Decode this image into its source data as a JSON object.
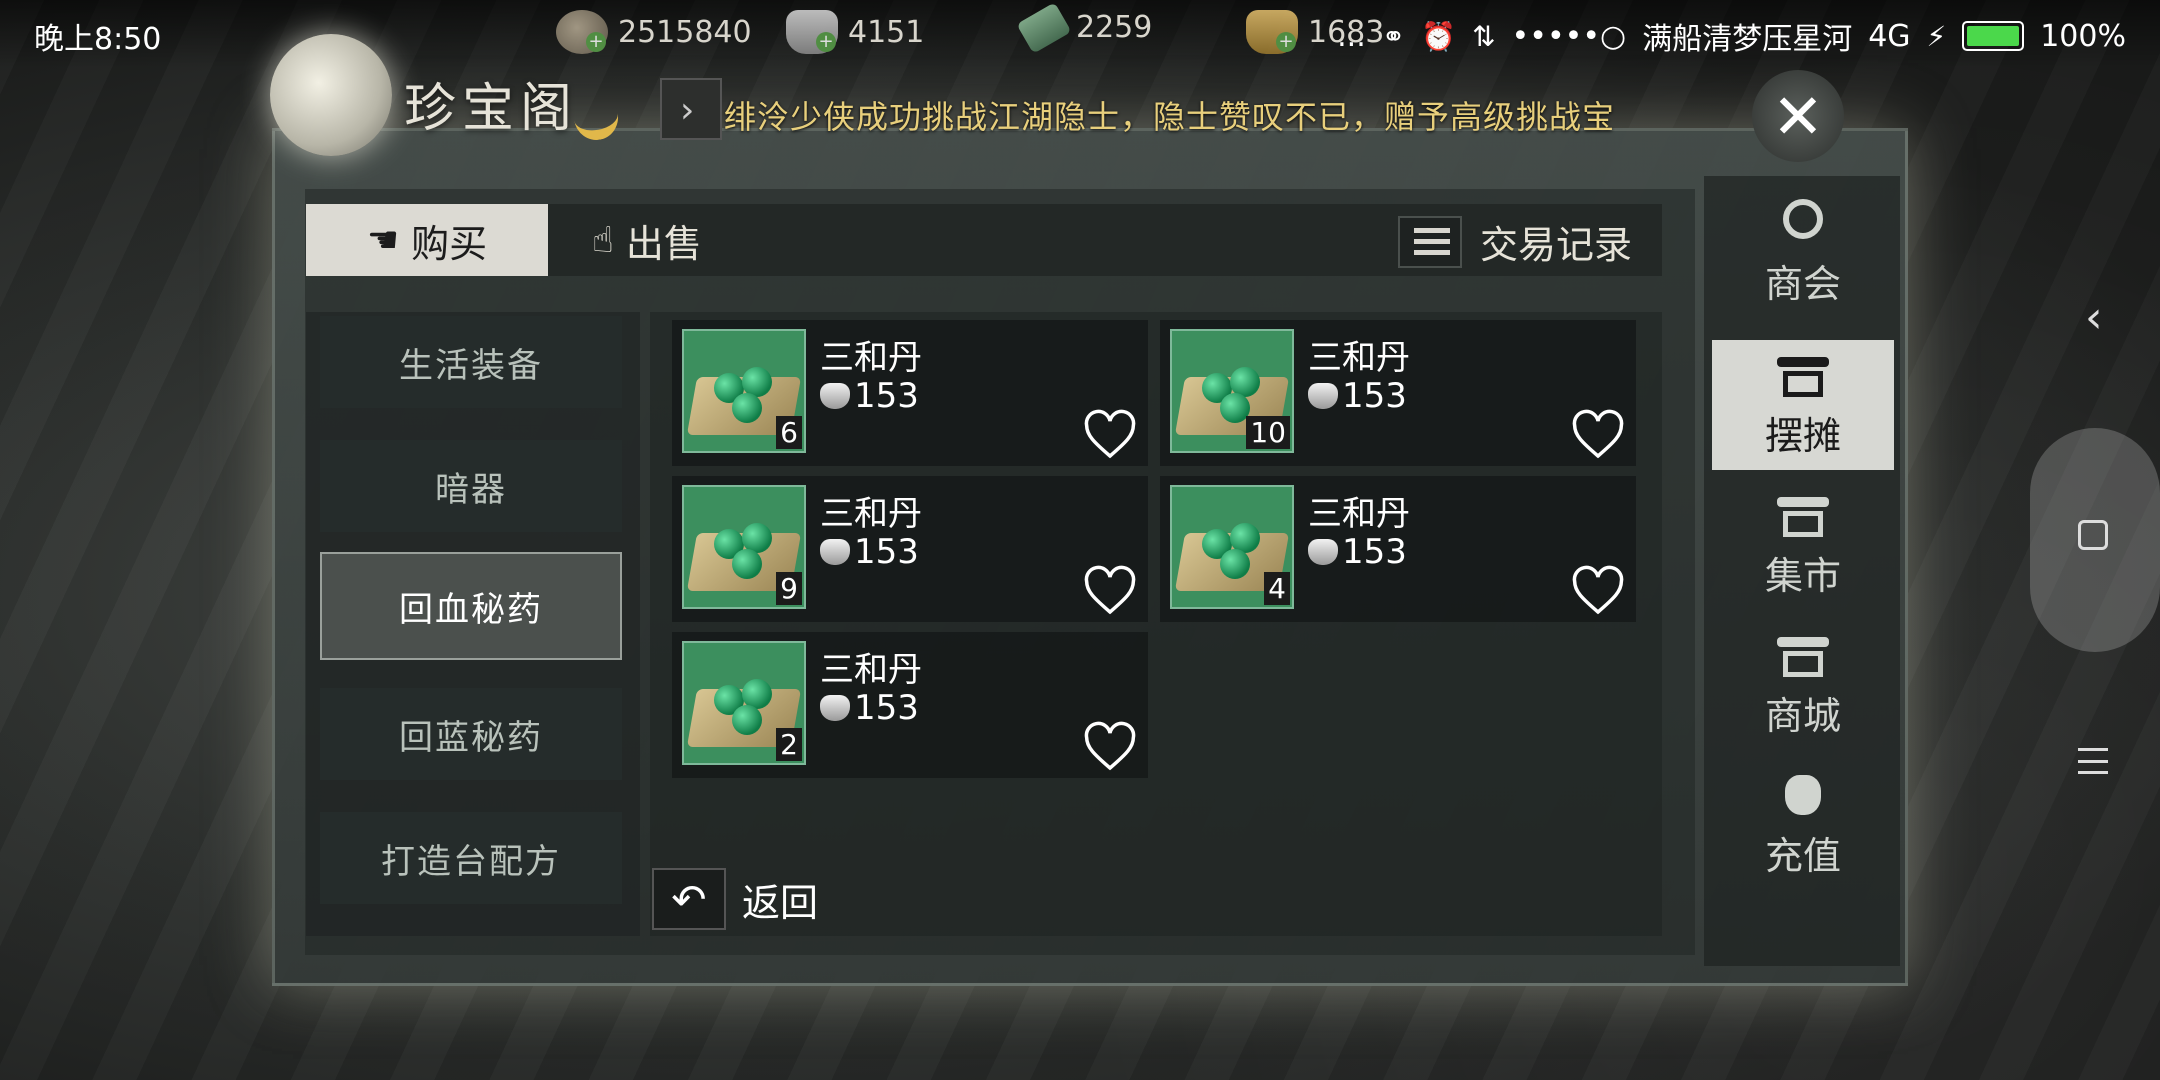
{
  "status_bar": {
    "time": "晚上8:50",
    "carrier": "满船清梦压星河",
    "network": "4G",
    "battery": "100%",
    "signal": "•••••○",
    "misc": "..."
  },
  "resources": [
    {
      "icon": "token-icon",
      "value": "2515840"
    },
    {
      "icon": "silver-ingot-icon",
      "value": "4151"
    },
    {
      "icon": "ticket-icon",
      "value": "2259"
    },
    {
      "icon": "gold-ingot-icon",
      "value": "1683"
    }
  ],
  "header": {
    "title": "珍宝阁",
    "marquee": "绯泠少侠成功挑战江湖隐士，隐士赞叹不已，赠予高级挑战宝",
    "close_icon": "close-icon"
  },
  "tabs": {
    "buy": "购买",
    "sell": "出售",
    "records": "交易记录",
    "active": "buy"
  },
  "categories": [
    {
      "label": "生活装备",
      "active": false
    },
    {
      "label": "暗器",
      "active": false
    },
    {
      "label": "回血秘药",
      "active": true
    },
    {
      "label": "回蓝秘药",
      "active": false
    },
    {
      "label": "打造台配方",
      "active": false
    }
  ],
  "items": [
    {
      "name": "三和丹",
      "price": "153",
      "qty": "6"
    },
    {
      "name": "三和丹",
      "price": "153",
      "qty": "10"
    },
    {
      "name": "三和丹",
      "price": "153",
      "qty": "9"
    },
    {
      "name": "三和丹",
      "price": "153",
      "qty": "4"
    },
    {
      "name": "三和丹",
      "price": "153",
      "qty": "2"
    }
  ],
  "back_label": "返回",
  "side_nav": [
    {
      "label": "商会",
      "icon": "guild-emblem-icon",
      "active": false
    },
    {
      "label": "摆摊",
      "icon": "stall-icon",
      "active": true
    },
    {
      "label": "集市",
      "icon": "market-icon",
      "active": false
    },
    {
      "label": "商城",
      "icon": "mall-icon",
      "active": false
    },
    {
      "label": "充值",
      "icon": "money-bag-icon",
      "active": false
    }
  ],
  "colors": {
    "accent_gold": "#e8cf7c",
    "tab_active_bg": "#dcdad3",
    "item_bg_green": "#3c8f5e"
  }
}
